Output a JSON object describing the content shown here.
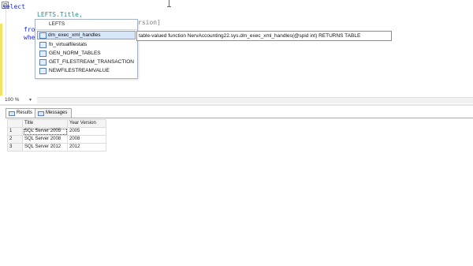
{
  "editor": {
    "outline_toggle": "⊟",
    "lines": [
      {
        "kind": "kw",
        "text": "select"
      },
      {
        "kind": "teal",
        "text": "LEFTS.Title,"
      },
      {
        "kind": "gray",
        "text": "rsion]"
      },
      {
        "kind": "kw",
        "text": "from"
      },
      {
        "kind": "kw",
        "text": "wher"
      }
    ]
  },
  "completion": {
    "header": "LEFTS",
    "items": [
      {
        "label": "dm_exec_xml_handles",
        "selected": true
      },
      {
        "label": "fn_virtualfilestats"
      },
      {
        "label": "GEN_NORM_TABLES"
      },
      {
        "label": "GET_FILESTREAM_TRANSACTION"
      },
      {
        "label": "NEWFILESTREAMVALUE"
      }
    ],
    "tooltip": "table-valued function NervAccounting22.sys.dm_exec_xml_handles(@spid int) RETURNS TABLE"
  },
  "statusbar": {
    "zoom": "100 %"
  },
  "results": {
    "tabs": [
      {
        "label": "Results",
        "active": true
      },
      {
        "label": "Messages"
      }
    ],
    "columns": [
      "Title",
      "Year Version"
    ],
    "rows": [
      {
        "num": "1",
        "cells": [
          "SQL Server 2005",
          "2005"
        ]
      },
      {
        "num": "2",
        "cells": [
          "SQL Server 2008",
          "2008"
        ]
      },
      {
        "num": "3",
        "cells": [
          "SQL Server 2012",
          "2012"
        ]
      }
    ]
  }
}
